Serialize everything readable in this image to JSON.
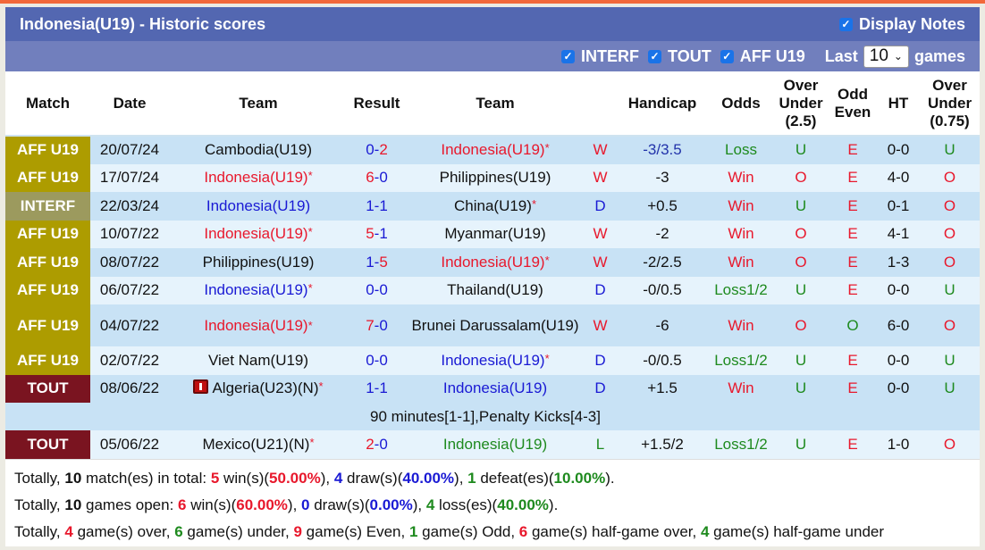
{
  "title": "Indonesia(U19) - Historic scores",
  "display_notes": {
    "label": "Display Notes",
    "checked": true
  },
  "filters": [
    {
      "label": "INTERF",
      "checked": true
    },
    {
      "label": "TOUT",
      "checked": true
    },
    {
      "label": "AFF U19",
      "checked": true
    }
  ],
  "last_label": "Last",
  "last_value": "10",
  "games_label": "games",
  "colors": {
    "header_bg": "#5367b1",
    "filter_bg": "#717fbd",
    "aff_u19": "#ad9c00",
    "interf": "#9c9a5e",
    "tout": "#7a1420",
    "win_red": "#e8182c",
    "draw_blue": "#1a1ad4",
    "loss_green": "#1e8a1e"
  },
  "columns": [
    "Match",
    "Date",
    "Team",
    "Result",
    "Team",
    "",
    "Handicap",
    "Odds",
    "Over\nUnder\n(2.5)",
    "Odd\nEven",
    "HT",
    "Over\nUnder\n(0.75)"
  ],
  "col_labels": {
    "match": "Match",
    "date": "Date",
    "home": "Team",
    "result": "Result",
    "away": "Team",
    "handicap": "Handicap",
    "odds": "Odds",
    "ou25_1": "Over",
    "ou25_2": "Under",
    "ou25_3": "(2.5)",
    "oe_1": "Odd",
    "oe_2": "Even",
    "ht": "HT",
    "ou075_1": "Over",
    "ou075_2": "Under",
    "ou075_3": "(0.75)"
  },
  "rows": [
    {
      "match": "AFF U19",
      "date": "20/07/24",
      "home": "Cambodia(U19)",
      "home_star": "",
      "h": "0",
      "a": "2",
      "away": "Indonesia(U19)",
      "away_star": "*",
      "wdl": "W",
      "handicap": "-3/3.5",
      "odds": "Loss",
      "ou": "U",
      "oe": "E",
      "ht": "0-0",
      "ou2": "U"
    },
    {
      "match": "AFF U19",
      "date": "17/07/24",
      "home": "Indonesia(U19)",
      "home_star": "*",
      "h": "6",
      "a": "0",
      "away": "Philippines(U19)",
      "away_star": "",
      "wdl": "W",
      "handicap": "-3",
      "odds": "Win",
      "ou": "O",
      "oe": "E",
      "ht": "4-0",
      "ou2": "O"
    },
    {
      "match": "INTERF",
      "date": "22/03/24",
      "home": "Indonesia(U19)",
      "home_star": "",
      "h": "1",
      "a": "1",
      "away": "China(U19)",
      "away_star": "*",
      "wdl": "D",
      "handicap": "+0.5",
      "odds": "Win",
      "ou": "U",
      "oe": "E",
      "ht": "0-1",
      "ou2": "O"
    },
    {
      "match": "AFF U19",
      "date": "10/07/22",
      "home": "Indonesia(U19)",
      "home_star": "*",
      "h": "5",
      "a": "1",
      "away": "Myanmar(U19)",
      "away_star": "",
      "wdl": "W",
      "handicap": "-2",
      "odds": "Win",
      "ou": "O",
      "oe": "E",
      "ht": "4-1",
      "ou2": "O"
    },
    {
      "match": "AFF U19",
      "date": "08/07/22",
      "home": "Philippines(U19)",
      "home_star": "",
      "h": "1",
      "a": "5",
      "away": "Indonesia(U19)",
      "away_star": "*",
      "wdl": "W",
      "handicap": "-2/2.5",
      "odds": "Win",
      "ou": "O",
      "oe": "E",
      "ht": "1-3",
      "ou2": "O"
    },
    {
      "match": "AFF U19",
      "date": "06/07/22",
      "home": "Indonesia(U19)",
      "home_star": "*",
      "h": "0",
      "a": "0",
      "away": "Thailand(U19)",
      "away_star": "",
      "wdl": "D",
      "handicap": "-0/0.5",
      "odds": "Loss1/2",
      "ou": "U",
      "oe": "E",
      "ht": "0-0",
      "ou2": "U"
    },
    {
      "match": "AFF U19",
      "date": "04/07/22",
      "home": "Indonesia(U19)",
      "home_star": "*",
      "h": "7",
      "a": "0",
      "away": "Brunei Darussalam(U19)",
      "away_star": "",
      "wdl": "W",
      "handicap": "-6",
      "odds": "Win",
      "ou": "O",
      "oe": "O",
      "ht": "6-0",
      "ou2": "O"
    },
    {
      "match": "AFF U19",
      "date": "02/07/22",
      "home": "Viet Nam(U19)",
      "home_star": "",
      "h": "0",
      "a": "0",
      "away": "Indonesia(U19)",
      "away_star": "*",
      "wdl": "D",
      "handicap": "-0/0.5",
      "odds": "Loss1/2",
      "ou": "U",
      "oe": "E",
      "ht": "0-0",
      "ou2": "U"
    },
    {
      "match": "TOUT",
      "date": "08/06/22",
      "home": "Algeria(U23)(N)",
      "home_star": "*",
      "h": "1",
      "a": "1",
      "away": "Indonesia(U19)",
      "away_star": "",
      "wdl": "D",
      "handicap": "+1.5",
      "odds": "Win",
      "ou": "U",
      "oe": "E",
      "ht": "0-0",
      "ou2": "U",
      "note": "90 minutes[1-1],Penalty Kicks[4-3]"
    },
    {
      "match": "TOUT",
      "date": "05/06/22",
      "home": "Mexico(U21)(N)",
      "home_star": "*",
      "h": "2",
      "a": "0",
      "away": "Indonesia(U19)",
      "away_star": "",
      "wdl": "L",
      "handicap": "+1.5/2",
      "odds": "Loss1/2",
      "ou": "U",
      "oe": "E",
      "ht": "1-0",
      "ou2": "O"
    }
  ],
  "summary": {
    "line1": {
      "p1": "Totally, ",
      "total": "10",
      "p2": " match(es) in total: ",
      "wins": "5",
      "p3": " win(s)(",
      "win_pct": "50.00%",
      "p4": "), ",
      "draws": "4",
      "p5": " draw(s)(",
      "draw_pct": "40.00%",
      "p6": "), ",
      "losses": "1",
      "p7": " defeat(es)(",
      "loss_pct": "10.00%",
      "p8": ")."
    },
    "line2": {
      "p1": "Totally, ",
      "total": "10",
      "p2": " games open: ",
      "wins": "6",
      "p3": " win(s)(",
      "win_pct": "60.00%",
      "p4": "), ",
      "draws": "0",
      "p5": " draw(s)(",
      "draw_pct": "0.00%",
      "p6": "), ",
      "losses": "4",
      "p7": " loss(es)(",
      "loss_pct": "40.00%",
      "p8": ")."
    },
    "line3": {
      "p1": "Totally, ",
      "over": "4",
      "p2": " game(s) over, ",
      "under": "6",
      "p3": " game(s) under, ",
      "even": "9",
      "p4": " game(s) Even, ",
      "odd": "1",
      "p5": " game(s) Odd, ",
      "hg_over": "6",
      "p6": " game(s) half-game over, ",
      "hg_under": "4",
      "p7": " game(s) half-game under"
    }
  }
}
